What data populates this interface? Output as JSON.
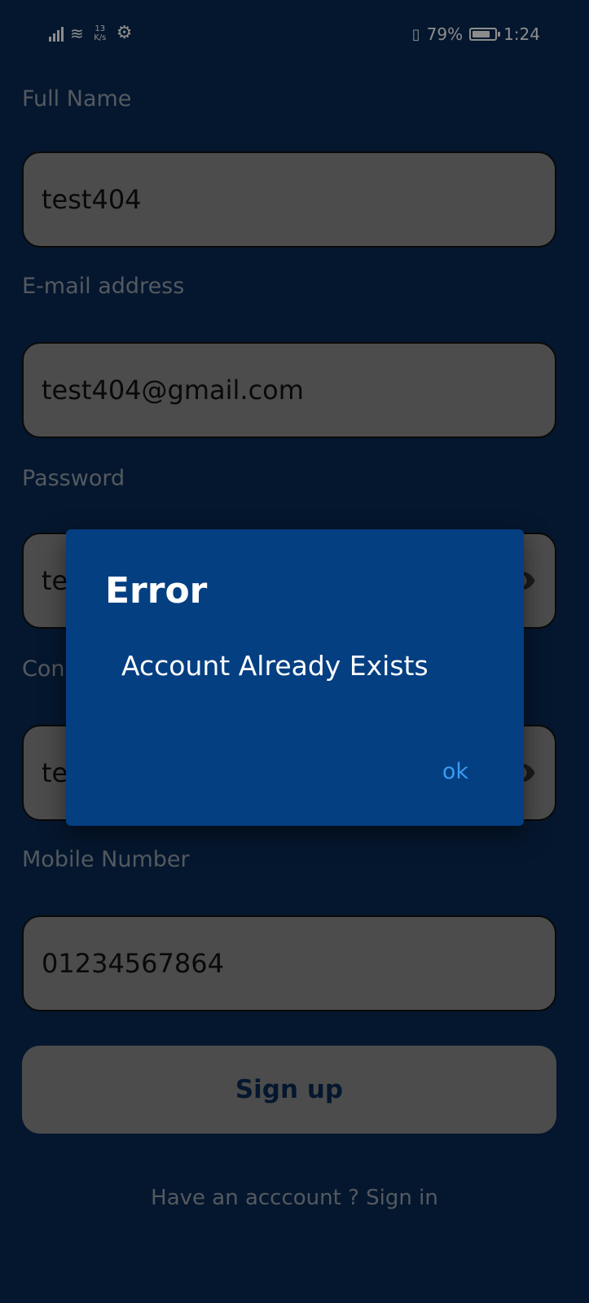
{
  "status_bar": {
    "network_speed": "13\nK/s",
    "battery_percent": "79%",
    "time": "1:24",
    "battery_level": 0.79,
    "icons": [
      "signal-icon",
      "wifi-icon",
      "gear-icon",
      "vibrate-icon",
      "battery-icon"
    ]
  },
  "form": {
    "full_name": {
      "label": "Full Name",
      "value": "test404"
    },
    "email": {
      "label": "E-mail address",
      "value": "test404@gmail.com"
    },
    "password": {
      "label": "Password",
      "value": "te"
    },
    "confirm": {
      "label": "Con",
      "value": "te"
    },
    "mobile": {
      "label": "Mobile Number",
      "value": "01234567864"
    },
    "signup_label": "Sign up",
    "signin_text": "Have an acccount ? Sign in"
  },
  "dialog": {
    "title": "Error",
    "message": "Account Already Exists",
    "ok_label": "ok"
  },
  "colors": {
    "background": "#0a2a55",
    "field_bg": "#8a8a8a",
    "dialog_bg": "#043f82",
    "accent": "#3b9bf0",
    "label": "#9aa3af"
  }
}
